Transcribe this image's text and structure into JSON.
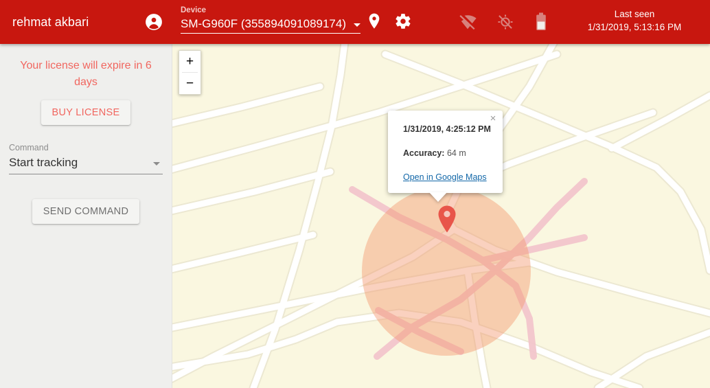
{
  "header": {
    "brand_title": "rehmat akbari",
    "account_icon": "account-circle-icon",
    "device_label": "Device",
    "device_value": "SM-G960F (355894091089174)",
    "dropdown_icon": "chevron-down-icon",
    "status_icons": [
      {
        "name": "place-icon",
        "state": "active"
      },
      {
        "name": "settings-gear-icon",
        "state": "active"
      },
      {
        "name": "wifi-off-icon",
        "state": "dimmed"
      },
      {
        "name": "location-disabled-icon",
        "state": "dimmed"
      },
      {
        "name": "battery-low-icon",
        "state": "dimmed"
      }
    ],
    "last_seen_label": "Last seen",
    "last_seen_value": "1/31/2019, 5:13:16 PM",
    "background_color": "#C8170F"
  },
  "sidebar": {
    "license_message": "Your license will expire in 6 days",
    "buy_license_label": "BUY LICENSE",
    "command_label": "Command",
    "command_value": "Start tracking",
    "send_command_label": "SEND COMMAND",
    "warning_color": "#f1665f",
    "background_color": "#EFEFED"
  },
  "map": {
    "zoom_in_label": "+",
    "zoom_out_label": "−",
    "marker_icon": "map-pin-icon",
    "accuracy_circle_color": "#F49970",
    "background_color": "#FAF7E0",
    "road_color": "#FFFFFF",
    "highlight_road_color": "#F5C6CB",
    "info_window": {
      "timestamp": "1/31/2019, 4:25:12 PM",
      "accuracy_label": "Accuracy:",
      "accuracy_value": "64 m",
      "open_link_label": "Open in Google Maps",
      "close_icon": "×",
      "link_color": "#1267a8"
    }
  }
}
